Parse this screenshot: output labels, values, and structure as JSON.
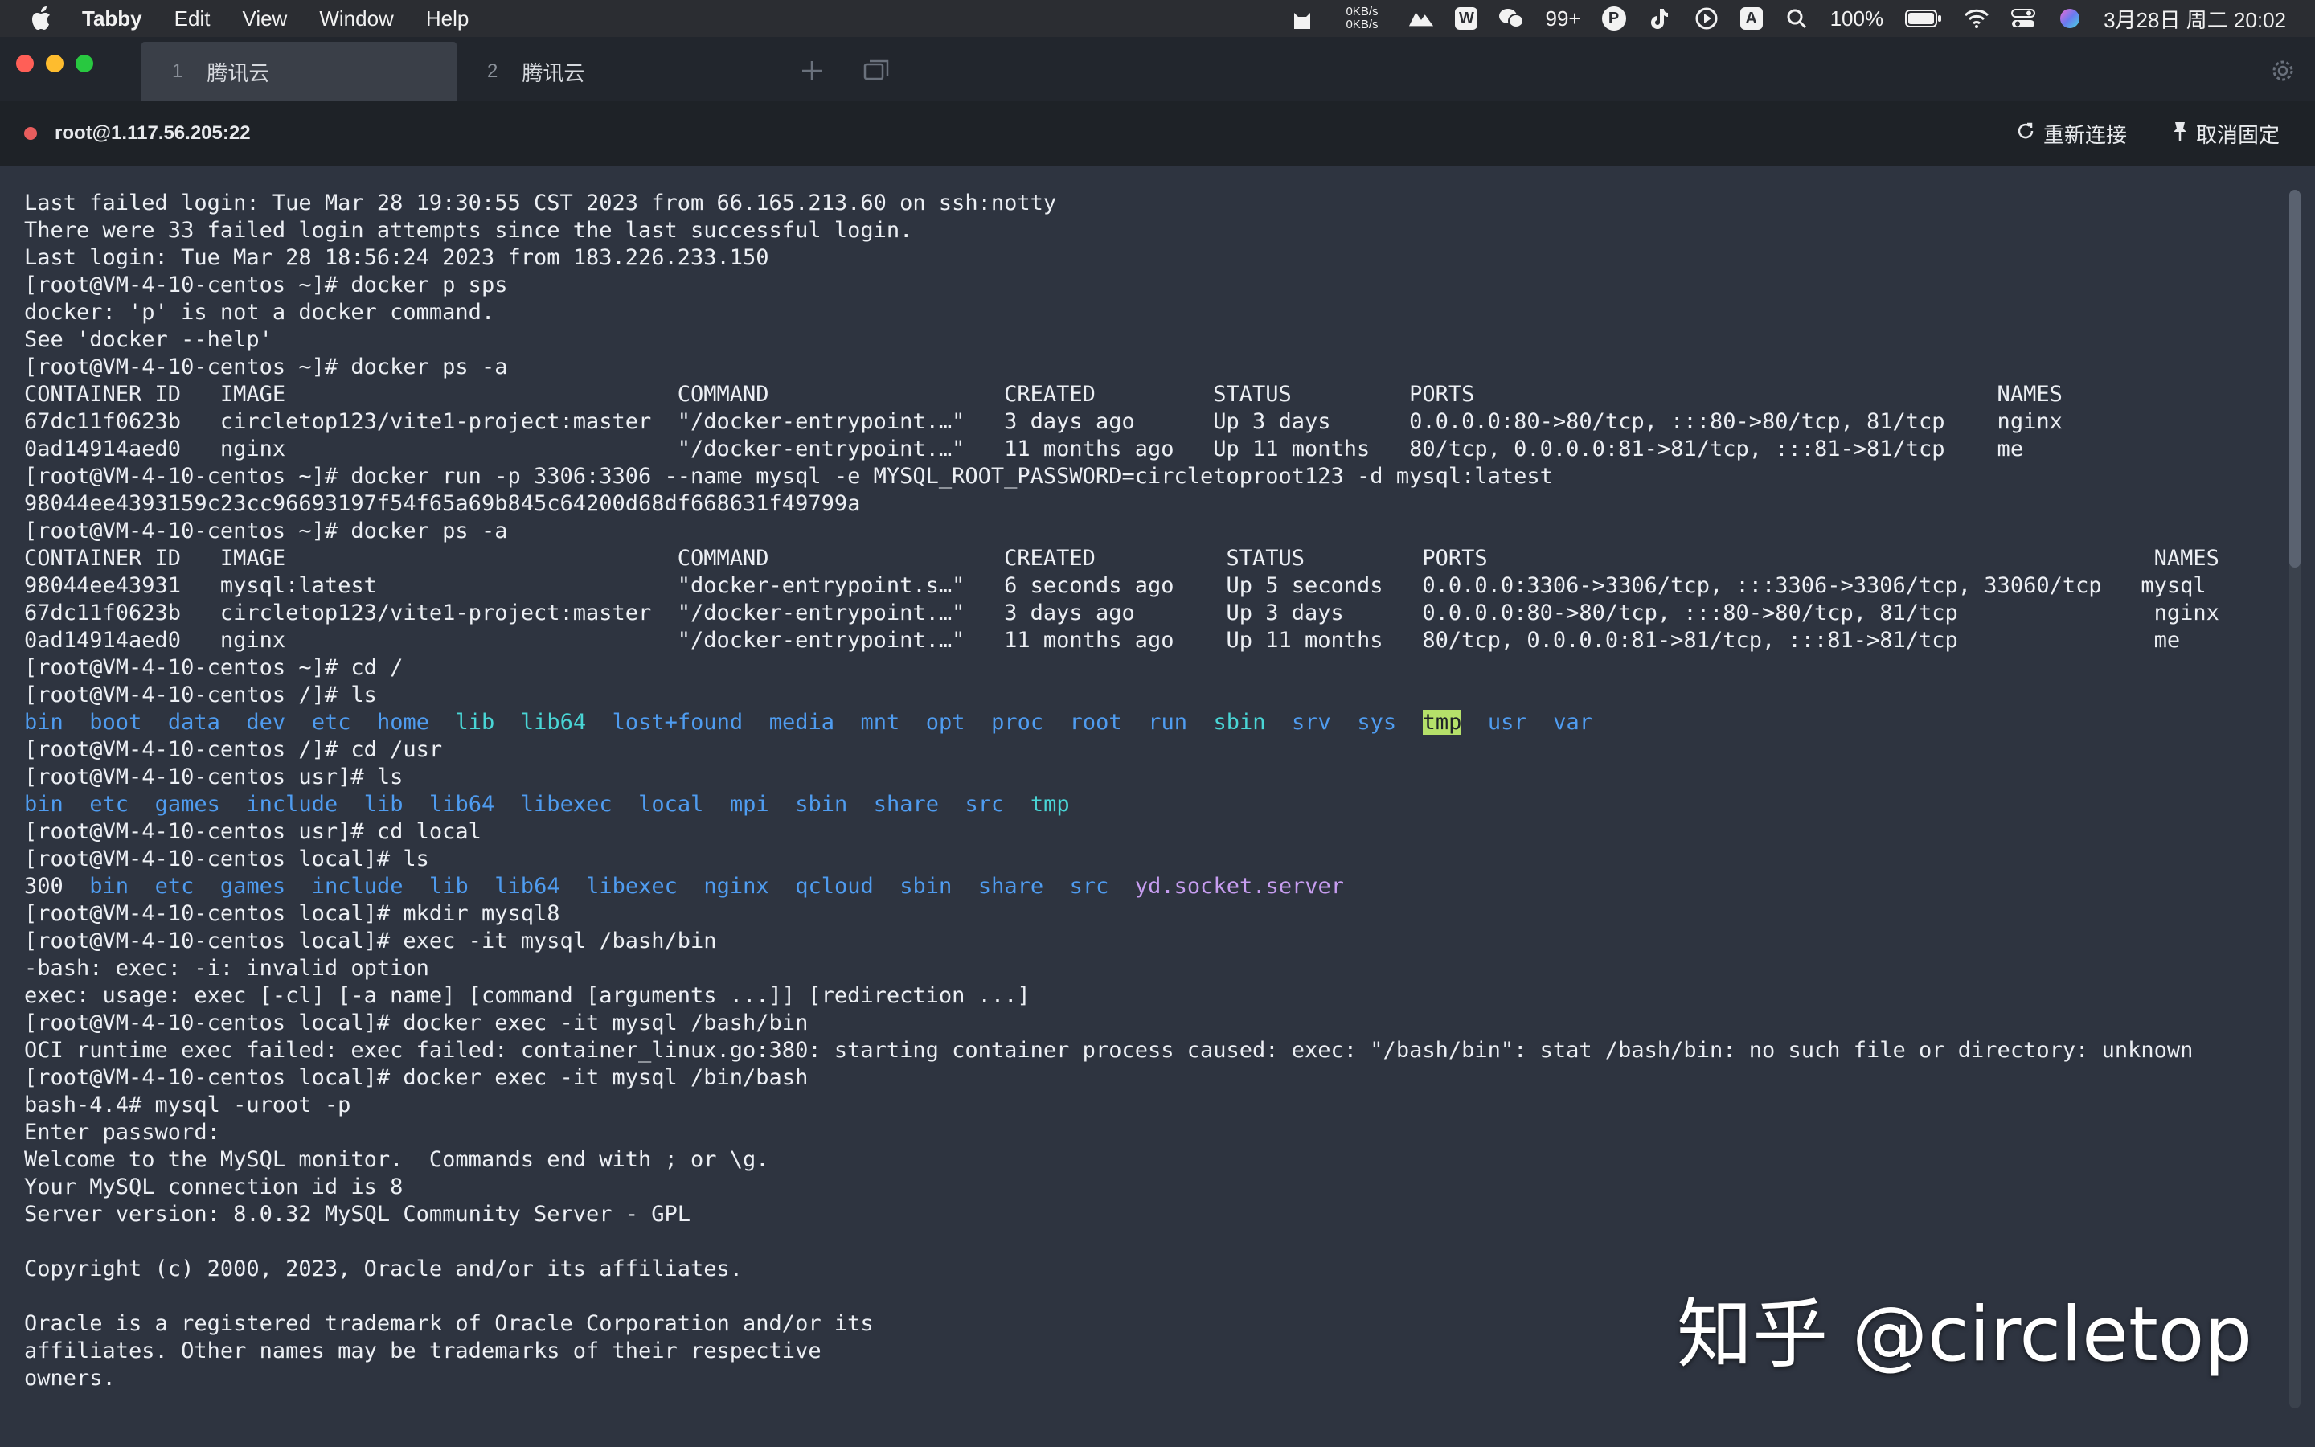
{
  "menubar": {
    "app_name": "Tabby",
    "menus": [
      "Edit",
      "View",
      "Window",
      "Help"
    ],
    "net_up": "0KB/s",
    "net_down": "0KB/s",
    "notification_count": "99+",
    "battery": "100%",
    "datetime": "3月28日 周二 20:02",
    "status_letters": {
      "p": "P",
      "a": "A"
    }
  },
  "tabs": [
    {
      "index": "1",
      "title": "腾讯云"
    },
    {
      "index": "2",
      "title": "腾讯云"
    }
  ],
  "session": {
    "host": "root@1.117.56.205:22",
    "reconnect_label": "重新连接",
    "unpin_label": "取消固定"
  },
  "terminal": {
    "lines": [
      [
        {
          "t": "Last failed login: Tue Mar 28 19:30:55 CST 2023 from 66.165.213.60 on ssh:notty"
        }
      ],
      [
        {
          "t": "There were 33 failed login attempts since the last successful login."
        }
      ],
      [
        {
          "t": "Last login: Tue Mar 28 18:56:24 2023 from 183.226.233.150"
        }
      ],
      [
        {
          "t": "[root@VM-4-10-centos ~]# docker p sps"
        }
      ],
      [
        {
          "t": "docker: 'p' is not a docker command."
        }
      ],
      [
        {
          "t": "See 'docker --help'"
        }
      ],
      [
        {
          "t": "[root@VM-4-10-centos ~]# docker ps -a"
        }
      ],
      [
        {
          "t": "CONTAINER ID   IMAGE                              COMMAND                  CREATED         STATUS         PORTS                                        NAMES"
        }
      ],
      [
        {
          "t": "67dc11f0623b   circletop123/vite1-project:master  \"/docker-entrypoint.…\"   3 days ago      Up 3 days      0.0.0.0:80->80/tcp, :::80->80/tcp, 81/tcp    nginx"
        }
      ],
      [
        {
          "t": "0ad14914aed0   nginx                              \"/docker-entrypoint.…\"   11 months ago   Up 11 months   80/tcp, 0.0.0.0:81->81/tcp, :::81->81/tcp    me"
        }
      ],
      [
        {
          "t": "[root@VM-4-10-centos ~]# docker run -p 3306:3306 --name mysql -e MYSQL_ROOT_PASSWORD=circletoproot123 -d mysql:latest"
        }
      ],
      [
        {
          "t": "98044ee4393159c23cc96693197f54f65a69b845c64200d68df668631f49799a"
        }
      ],
      [
        {
          "t": "[root@VM-4-10-centos ~]# docker ps -a"
        }
      ],
      [
        {
          "t": "CONTAINER ID   IMAGE                              COMMAND                  CREATED          STATUS         PORTS                                                   NAMES"
        }
      ],
      [
        {
          "t": "98044ee43931   mysql:latest                       \"docker-entrypoint.s…\"   6 seconds ago    Up 5 seconds   0.0.0.0:3306->3306/tcp, :::3306->3306/tcp, 33060/tcp   mysql"
        }
      ],
      [
        {
          "t": "67dc11f0623b   circletop123/vite1-project:master  \"/docker-entrypoint.…\"   3 days ago       Up 3 days      0.0.0.0:80->80/tcp, :::80->80/tcp, 81/tcp               nginx"
        }
      ],
      [
        {
          "t": "0ad14914aed0   nginx                              \"/docker-entrypoint.…\"   11 months ago    Up 11 months   80/tcp, 0.0.0.0:81->81/tcp, :::81->81/tcp               me"
        }
      ],
      [
        {
          "t": "[root@VM-4-10-centos ~]# cd /"
        }
      ],
      [
        {
          "t": "[root@VM-4-10-centos /]# ls"
        }
      ],
      [
        {
          "t": "bin",
          "c": "dir"
        },
        {
          "t": "  "
        },
        {
          "t": "boot",
          "c": "dir"
        },
        {
          "t": "  "
        },
        {
          "t": "data",
          "c": "dir"
        },
        {
          "t": "  "
        },
        {
          "t": "dev",
          "c": "dir"
        },
        {
          "t": "  "
        },
        {
          "t": "etc",
          "c": "dir"
        },
        {
          "t": "  "
        },
        {
          "t": "home",
          "c": "dir"
        },
        {
          "t": "  "
        },
        {
          "t": "lib",
          "c": "exe"
        },
        {
          "t": "  "
        },
        {
          "t": "lib64",
          "c": "exe"
        },
        {
          "t": "  "
        },
        {
          "t": "lost+found",
          "c": "dir"
        },
        {
          "t": "  "
        },
        {
          "t": "media",
          "c": "dir"
        },
        {
          "t": "  "
        },
        {
          "t": "mnt",
          "c": "dir"
        },
        {
          "t": "  "
        },
        {
          "t": "opt",
          "c": "dir"
        },
        {
          "t": "  "
        },
        {
          "t": "proc",
          "c": "dir"
        },
        {
          "t": "  "
        },
        {
          "t": "root",
          "c": "dir"
        },
        {
          "t": "  "
        },
        {
          "t": "run",
          "c": "dir"
        },
        {
          "t": "  "
        },
        {
          "t": "sbin",
          "c": "exe"
        },
        {
          "t": "  "
        },
        {
          "t": "srv",
          "c": "dir"
        },
        {
          "t": "  "
        },
        {
          "t": "sys",
          "c": "dir"
        },
        {
          "t": "  "
        },
        {
          "t": "tmp",
          "c": "hl"
        },
        {
          "t": "  "
        },
        {
          "t": "usr",
          "c": "dir"
        },
        {
          "t": "  "
        },
        {
          "t": "var",
          "c": "dir"
        }
      ],
      [
        {
          "t": "[root@VM-4-10-centos /]# cd /usr"
        }
      ],
      [
        {
          "t": "[root@VM-4-10-centos usr]# ls"
        }
      ],
      [
        {
          "t": "bin",
          "c": "dir"
        },
        {
          "t": "  "
        },
        {
          "t": "etc",
          "c": "dir"
        },
        {
          "t": "  "
        },
        {
          "t": "games",
          "c": "dir"
        },
        {
          "t": "  "
        },
        {
          "t": "include",
          "c": "dir"
        },
        {
          "t": "  "
        },
        {
          "t": "lib",
          "c": "dir"
        },
        {
          "t": "  "
        },
        {
          "t": "lib64",
          "c": "dir"
        },
        {
          "t": "  "
        },
        {
          "t": "libexec",
          "c": "dir"
        },
        {
          "t": "  "
        },
        {
          "t": "local",
          "c": "dir"
        },
        {
          "t": "  "
        },
        {
          "t": "mpi",
          "c": "dir"
        },
        {
          "t": "  "
        },
        {
          "t": "sbin",
          "c": "dir"
        },
        {
          "t": "  "
        },
        {
          "t": "share",
          "c": "dir"
        },
        {
          "t": "  "
        },
        {
          "t": "src",
          "c": "dir"
        },
        {
          "t": "  "
        },
        {
          "t": "tmp",
          "c": "exe"
        }
      ],
      [
        {
          "t": "[root@VM-4-10-centos usr]# cd local"
        }
      ],
      [
        {
          "t": "[root@VM-4-10-centos local]# ls"
        }
      ],
      [
        {
          "t": "300",
          "c": "file"
        },
        {
          "t": "  "
        },
        {
          "t": "bin",
          "c": "dir"
        },
        {
          "t": "  "
        },
        {
          "t": "etc",
          "c": "dir"
        },
        {
          "t": "  "
        },
        {
          "t": "games",
          "c": "dir"
        },
        {
          "t": "  "
        },
        {
          "t": "include",
          "c": "dir"
        },
        {
          "t": "  "
        },
        {
          "t": "lib",
          "c": "dir"
        },
        {
          "t": "  "
        },
        {
          "t": "lib64",
          "c": "dir"
        },
        {
          "t": "  "
        },
        {
          "t": "libexec",
          "c": "dir"
        },
        {
          "t": "  "
        },
        {
          "t": "nginx",
          "c": "dir"
        },
        {
          "t": "  "
        },
        {
          "t": "qcloud",
          "c": "dir"
        },
        {
          "t": "  "
        },
        {
          "t": "sbin",
          "c": "dir"
        },
        {
          "t": "  "
        },
        {
          "t": "share",
          "c": "dir"
        },
        {
          "t": "  "
        },
        {
          "t": "src",
          "c": "dir"
        },
        {
          "t": "  "
        },
        {
          "t": "yd.socket.server",
          "c": "special"
        }
      ],
      [
        {
          "t": "[root@VM-4-10-centos local]# mkdir mysql8"
        }
      ],
      [
        {
          "t": "[root@VM-4-10-centos local]# exec -it mysql /bash/bin"
        }
      ],
      [
        {
          "t": "-bash: exec: -i: invalid option"
        }
      ],
      [
        {
          "t": "exec: usage: exec [-cl] [-a name] [command [arguments ...]] [redirection ...]"
        }
      ],
      [
        {
          "t": "[root@VM-4-10-centos local]# docker exec -it mysql /bash/bin"
        }
      ],
      [
        {
          "t": "OCI runtime exec failed: exec failed: container_linux.go:380: starting container process caused: exec: \"/bash/bin\": stat /bash/bin: no such file or directory: unknown"
        }
      ],
      [
        {
          "t": "[root@VM-4-10-centos local]# docker exec -it mysql /bin/bash"
        }
      ],
      [
        {
          "t": "bash-4.4# mysql -uroot -p"
        }
      ],
      [
        {
          "t": "Enter password:"
        }
      ],
      [
        {
          "t": "Welcome to the MySQL monitor.  Commands end with ; or \\g."
        }
      ],
      [
        {
          "t": "Your MySQL connection id is 8"
        }
      ],
      [
        {
          "t": "Server version: 8.0.32 MySQL Community Server - GPL"
        }
      ],
      [
        {
          "t": ""
        }
      ],
      [
        {
          "t": "Copyright (c) 2000, 2023, Oracle and/or its affiliates."
        }
      ],
      [
        {
          "t": ""
        }
      ],
      [
        {
          "t": "Oracle is a registered trademark of Oracle Corporation and/or its"
        }
      ],
      [
        {
          "t": "affiliates. Other names may be trademarks of their respective"
        }
      ],
      [
        {
          "t": "owners."
        }
      ]
    ],
    "scroll_fraction": 0.31
  },
  "watermark": "知乎 @circletop",
  "colors": {
    "traffic_close": "#ff5f57",
    "traffic_min": "#febc2e",
    "traffic_max": "#28c840",
    "session_dot": "#e85d5d"
  }
}
